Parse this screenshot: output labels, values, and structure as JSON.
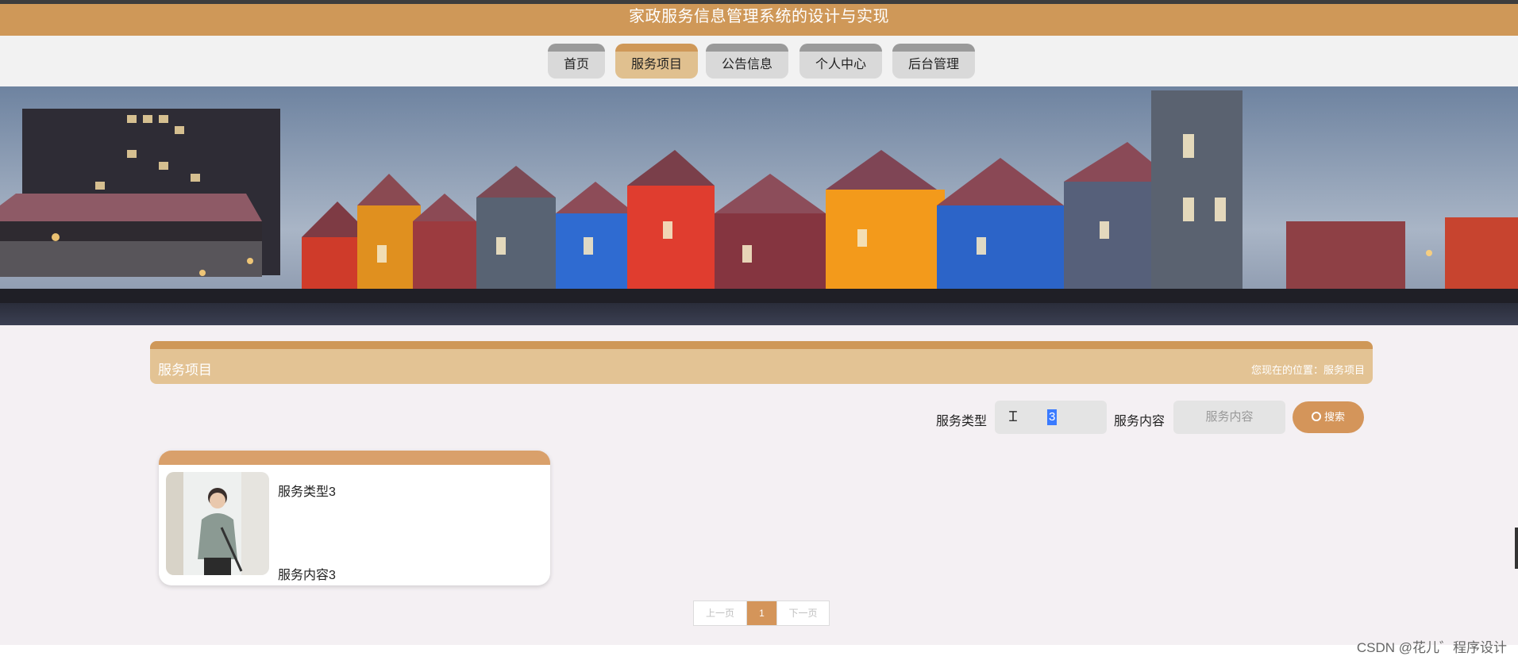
{
  "header": {
    "title": "家政服务信息管理系统的设计与实现"
  },
  "nav": {
    "items": [
      {
        "label": "首页"
      },
      {
        "label": "服务项目"
      },
      {
        "label": "公告信息"
      },
      {
        "label": "个人中心"
      },
      {
        "label": "后台管理"
      }
    ],
    "active": "服务项目"
  },
  "section": {
    "title": "服务项目",
    "breadcrumb": "您现在的位置：服务项目"
  },
  "filters": {
    "type_label": "服务类型",
    "type_value": "3",
    "content_label": "服务内容",
    "content_placeholder": "服务内容",
    "search_label": "搜索"
  },
  "cards": [
    {
      "type": "服务类型3",
      "content": "服务内容3"
    }
  ],
  "pager": {
    "prev": "上一页",
    "current": "1",
    "next": "下一页"
  },
  "watermark": "CSDN @花儿゛程序设计",
  "colors": {
    "accent": "#cf9858",
    "nav_active": "#e0c08f",
    "button": "#d4955a"
  },
  "icons": [
    "search-icon",
    "text-cursor-icon"
  ]
}
